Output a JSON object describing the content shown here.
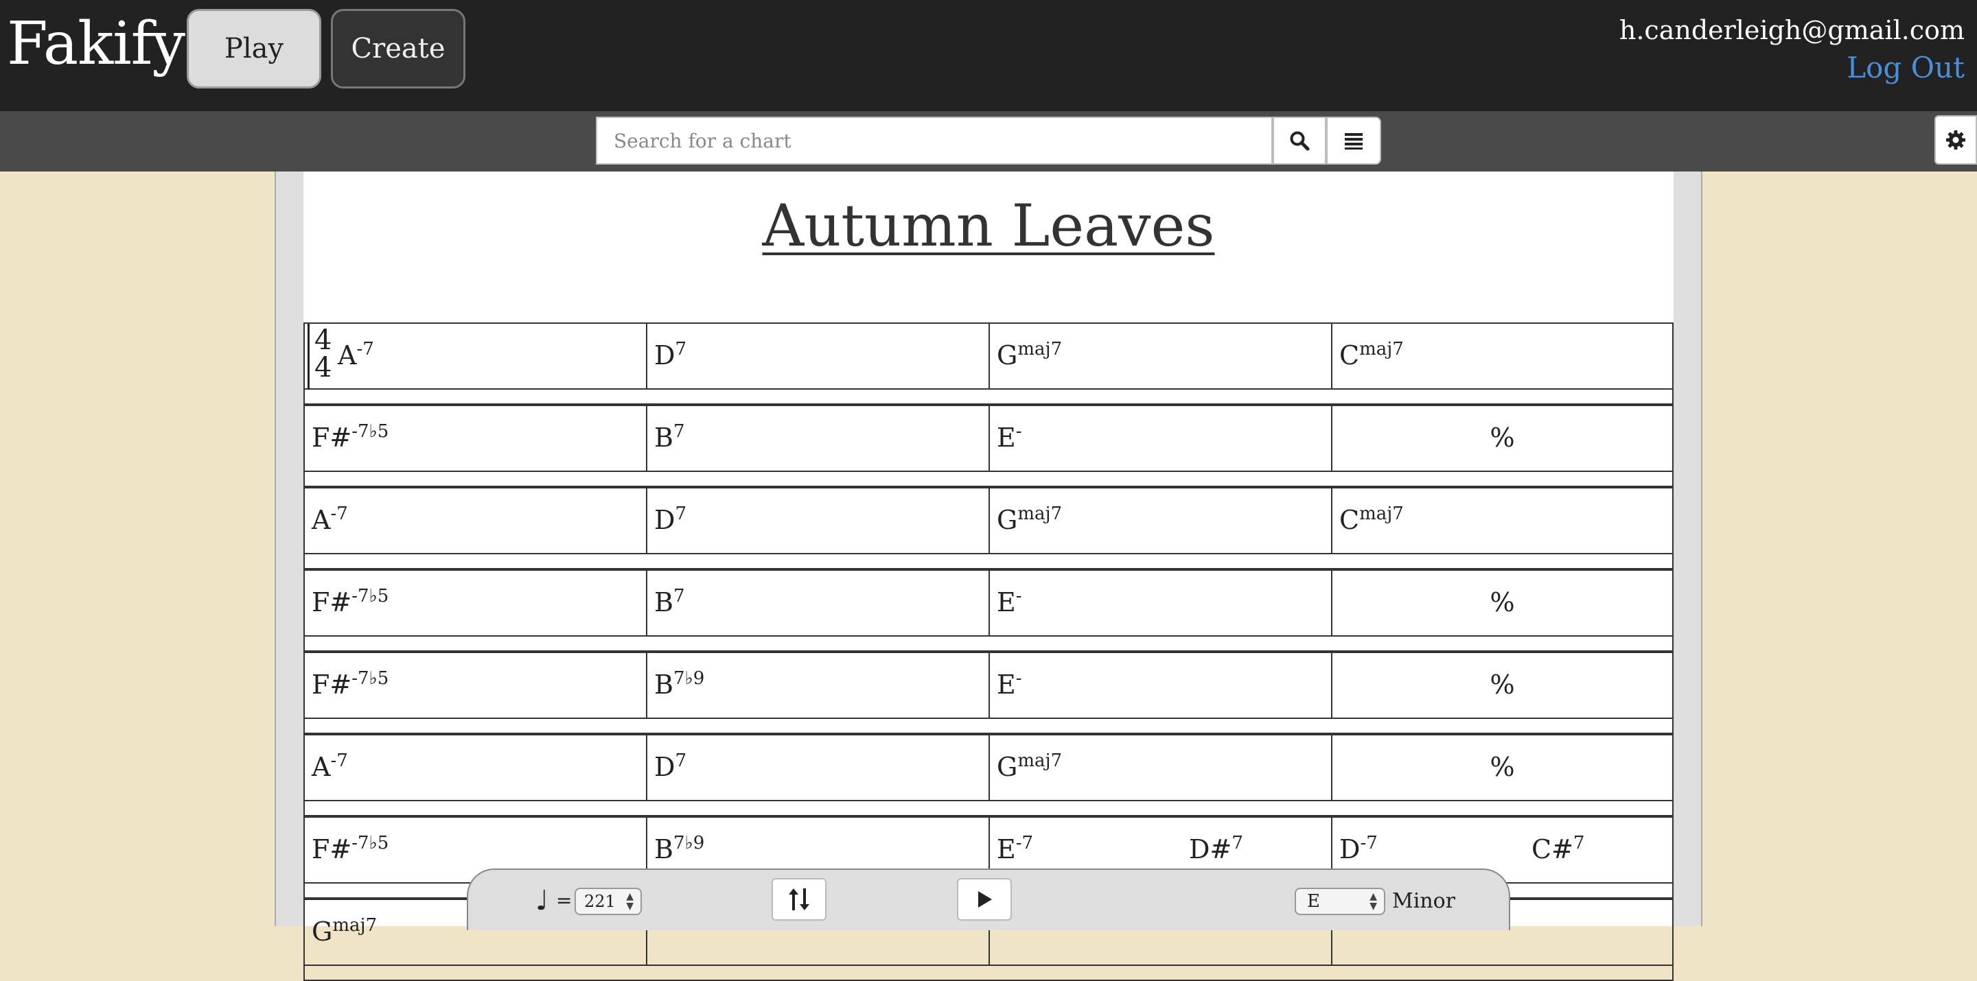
{
  "header": {
    "logo": "Fakify",
    "nav": [
      {
        "label": "Play",
        "active": true
      },
      {
        "label": "Create",
        "active": false
      }
    ],
    "user_email": "h.canderleigh@gmail.com",
    "logout_label": "Log Out",
    "accent_color": "#4a8fd8"
  },
  "search": {
    "placeholder": "Search for a chart",
    "value": "",
    "search_icon": "search-icon",
    "list_icon": "list-icon",
    "settings_icon": "gear-icon"
  },
  "chart": {
    "title": "Autumn Leaves",
    "time_signature": {
      "top": "4",
      "bottom": "4"
    },
    "rows": [
      [
        [
          {
            "root": "A",
            "q": "-7"
          }
        ],
        [
          {
            "root": "D",
            "q": "7"
          }
        ],
        [
          {
            "root": "G",
            "q": "maj7"
          }
        ],
        [
          {
            "root": "C",
            "q": "maj7"
          }
        ]
      ],
      [
        [
          {
            "root": "F#",
            "q": "-7♭5"
          }
        ],
        [
          {
            "root": "B",
            "q": "7"
          }
        ],
        [
          {
            "root": "E",
            "q": "-"
          }
        ],
        "%"
      ],
      [
        [
          {
            "root": "A",
            "q": "-7"
          }
        ],
        [
          {
            "root": "D",
            "q": "7"
          }
        ],
        [
          {
            "root": "G",
            "q": "maj7"
          }
        ],
        [
          {
            "root": "C",
            "q": "maj7"
          }
        ]
      ],
      [
        [
          {
            "root": "F#",
            "q": "-7♭5"
          }
        ],
        [
          {
            "root": "B",
            "q": "7"
          }
        ],
        [
          {
            "root": "E",
            "q": "-"
          }
        ],
        "%"
      ],
      [
        [
          {
            "root": "F#",
            "q": "-7♭5"
          }
        ],
        [
          {
            "root": "B",
            "q": "7♭9"
          }
        ],
        [
          {
            "root": "E",
            "q": "-"
          }
        ],
        "%"
      ],
      [
        [
          {
            "root": "A",
            "q": "-7"
          }
        ],
        [
          {
            "root": "D",
            "q": "7"
          }
        ],
        [
          {
            "root": "G",
            "q": "maj7"
          }
        ],
        "%"
      ],
      [
        [
          {
            "root": "F#",
            "q": "-7♭5"
          }
        ],
        [
          {
            "root": "B",
            "q": "7♭9"
          }
        ],
        [
          {
            "root": "E",
            "q": "-7"
          },
          {
            "root": "D#",
            "q": "7"
          }
        ],
        [
          {
            "root": "D",
            "q": "-7"
          },
          {
            "root": "C#",
            "q": "7"
          }
        ]
      ],
      [
        [
          {
            "root": "G",
            "q": "maj7"
          }
        ],
        [],
        [],
        []
      ]
    ]
  },
  "controls": {
    "tempo_note": "♩",
    "tempo_equals": "=",
    "tempo": "221",
    "transpose_icon": "sort-arrows-icon",
    "play_icon": "play-icon",
    "key": "E",
    "mode": "Minor"
  }
}
